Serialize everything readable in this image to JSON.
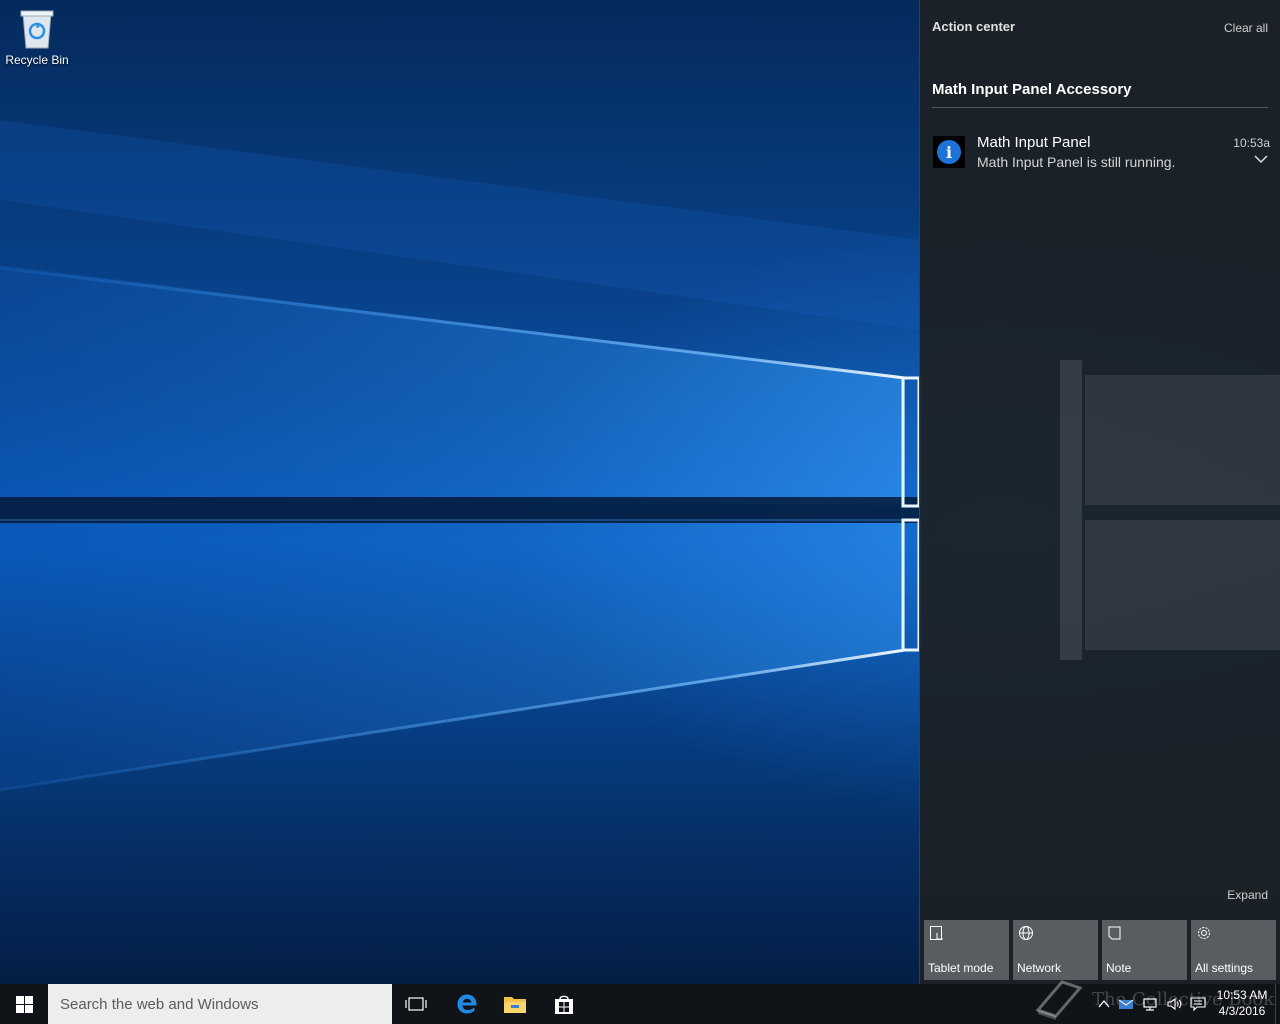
{
  "desktop": {
    "recycle_bin_label": "Recycle Bin"
  },
  "action_center": {
    "title": "Action center",
    "clear_all": "Clear all",
    "group_header": "Math Input Panel Accessory",
    "notification": {
      "title": "Math Input Panel",
      "body": "Math Input Panel is still running.",
      "time": "10:53a",
      "icon": "info-icon"
    },
    "expand_label": "Expand",
    "quick_actions": [
      {
        "label": "Tablet mode",
        "icon": "tablet-mode-icon"
      },
      {
        "label": "Network",
        "icon": "globe-icon"
      },
      {
        "label": "Note",
        "icon": "note-icon"
      },
      {
        "label": "All settings",
        "icon": "gear-icon"
      }
    ]
  },
  "taskbar": {
    "search_placeholder": "Search the web and Windows",
    "pinned": [
      "task-view-icon",
      "edge-icon",
      "file-explorer-icon",
      "store-icon"
    ],
    "watermark": "The Collective Book",
    "clock_time": "10:53 AM",
    "clock_date": "4/3/2016"
  },
  "colors": {
    "accent": "#1e73d8",
    "taskbar": "#101418",
    "action_center_bg": "#1c2024",
    "tile_bg": "#6e7276"
  }
}
